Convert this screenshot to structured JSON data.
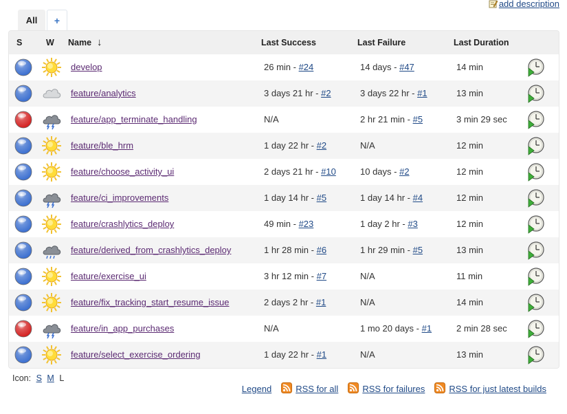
{
  "header": {
    "add_description": "add description"
  },
  "tabs": [
    {
      "label": "All"
    },
    {
      "label": "+"
    }
  ],
  "columns": {
    "s": "S",
    "w": "W",
    "name": "Name",
    "sort_arrow": "↓",
    "last_success": "Last Success",
    "last_failure": "Last Failure",
    "last_duration": "Last Duration"
  },
  "jobs": [
    {
      "name": "develop",
      "status": "blue",
      "weather": "sunny",
      "success_time": "26 min - ",
      "success_build": "#24",
      "failure_time": "14 days - ",
      "failure_build": "#47",
      "duration": "14 min"
    },
    {
      "name": "feature/analytics",
      "status": "blue",
      "weather": "cloudy",
      "success_time": "3 days 21 hr - ",
      "success_build": "#2",
      "failure_time": "3 days 22 hr - ",
      "failure_build": "#1",
      "duration": "13 min"
    },
    {
      "name": "feature/app_terminate_handling",
      "status": "red",
      "weather": "storm",
      "success_time": "N/A",
      "success_build": "",
      "failure_time": "2 hr 21 min - ",
      "failure_build": "#5",
      "duration": "3 min 29 sec"
    },
    {
      "name": "feature/ble_hrm",
      "status": "blue",
      "weather": "sunny",
      "success_time": "1 day 22 hr - ",
      "success_build": "#2",
      "failure_time": "N/A",
      "failure_build": "",
      "duration": "12 min"
    },
    {
      "name": "feature/choose_activity_ui",
      "status": "blue",
      "weather": "sunny",
      "success_time": "2 days 21 hr - ",
      "success_build": "#10",
      "failure_time": "10 days - ",
      "failure_build": "#2",
      "duration": "12 min"
    },
    {
      "name": "feature/ci_improvements",
      "status": "blue",
      "weather": "storm",
      "success_time": "1 day 14 hr - ",
      "success_build": "#5",
      "failure_time": "1 day 14 hr - ",
      "failure_build": "#4",
      "duration": "12 min"
    },
    {
      "name": "feature/crashlytics_deploy",
      "status": "blue",
      "weather": "sunny",
      "success_time": "49 min - ",
      "success_build": "#23",
      "failure_time": "1 day 2 hr - ",
      "failure_build": "#3",
      "duration": "12 min"
    },
    {
      "name": "feature/derived_from_crashlytics_deploy",
      "status": "blue",
      "weather": "rain",
      "success_time": "1 hr 28 min - ",
      "success_build": "#6",
      "failure_time": "1 hr 29 min - ",
      "failure_build": "#5",
      "duration": "13 min"
    },
    {
      "name": "feature/exercise_ui",
      "status": "blue",
      "weather": "sunny",
      "success_time": "3 hr 12 min - ",
      "success_build": "#7",
      "failure_time": "N/A",
      "failure_build": "",
      "duration": "11 min"
    },
    {
      "name": "feature/fix_tracking_start_resume_issue",
      "status": "blue",
      "weather": "sunny",
      "success_time": "2 days 2 hr - ",
      "success_build": "#1",
      "failure_time": "N/A",
      "failure_build": "",
      "duration": "14 min"
    },
    {
      "name": "feature/in_app_purchases",
      "status": "red",
      "weather": "storm",
      "success_time": "N/A",
      "success_build": "",
      "failure_time": "1 mo 20 days - ",
      "failure_build": "#1",
      "duration": "2 min 28 sec"
    },
    {
      "name": "feature/select_exercise_ordering",
      "status": "blue",
      "weather": "sunny",
      "success_time": "1 day 22 hr - ",
      "success_build": "#1",
      "failure_time": "N/A",
      "failure_build": "",
      "duration": "13 min"
    }
  ],
  "status_colors": {
    "blue": "#3b6fd0",
    "red": "#d42020"
  },
  "icon_size": {
    "label": "Icon:",
    "small": "S",
    "medium": "M",
    "large": "L"
  },
  "footer": {
    "legend": "Legend",
    "rss_all": "RSS for all",
    "rss_failures": "RSS for failures",
    "rss_latest": "RSS for just latest builds"
  }
}
